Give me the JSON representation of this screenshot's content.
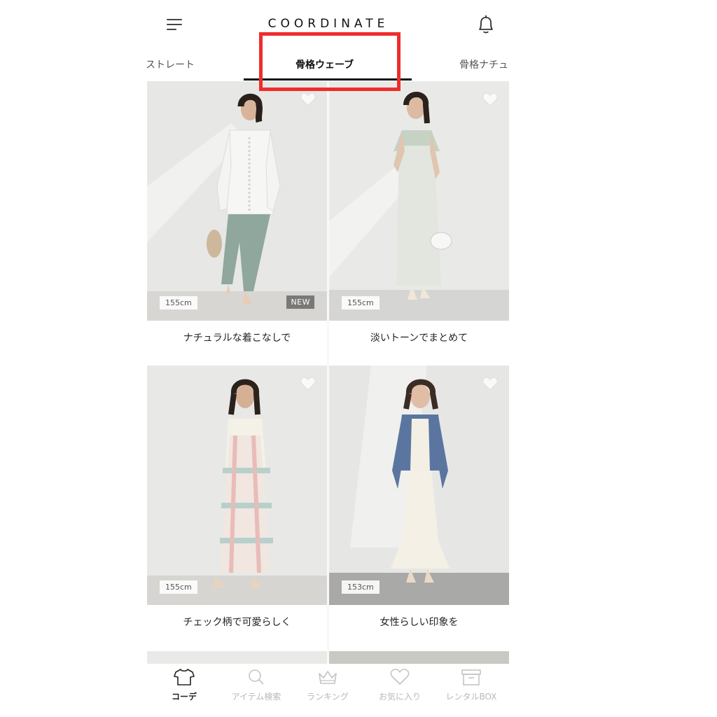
{
  "header": {
    "logo_text": "COORDINATE"
  },
  "tabs": [
    {
      "label": "ストレート"
    },
    {
      "label": "骨格ウェーブ"
    },
    {
      "label": "骨格ナチュ"
    }
  ],
  "cards": [
    {
      "height": "155cm",
      "badge": "NEW",
      "caption": "ナチュラルな着こなしで"
    },
    {
      "height": "155cm",
      "badge": "",
      "caption": "淡いトーンでまとめて"
    },
    {
      "height": "155cm",
      "badge": "",
      "caption": "チェック柄で可愛らしく"
    },
    {
      "height": "153cm",
      "badge": "",
      "caption": "女性らしい印象を"
    }
  ],
  "bottom_nav": [
    {
      "label": "コーデ",
      "icon": "tshirt-icon"
    },
    {
      "label": "アイテム検索",
      "icon": "search-icon"
    },
    {
      "label": "ランキング",
      "icon": "crown-icon"
    },
    {
      "label": "お気に入り",
      "icon": "heart-icon"
    },
    {
      "label": "レンタルBOX",
      "icon": "box-icon"
    }
  ],
  "colors": {
    "highlight": "#ee2d2d",
    "active_tab": "#111111",
    "inactive_nav": "#b8b8b8"
  }
}
